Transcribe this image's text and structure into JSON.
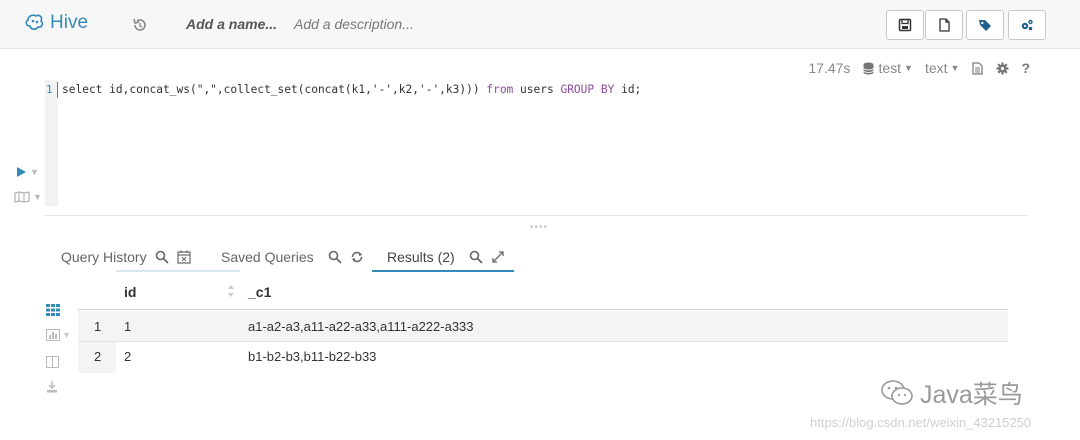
{
  "app": {
    "name": "Hive"
  },
  "header": {
    "name_placeholder": "Add a name...",
    "description_placeholder": "Add a description...",
    "buttons": [
      "save-icon",
      "new-file-icon",
      "tag-icon",
      "settings-cogs-icon"
    ]
  },
  "editor": {
    "elapsed": "17.47s",
    "database": "test",
    "format": "text",
    "line_number": "1",
    "query": {
      "p1": "select id,concat_ws(\",\",collect_set(concat(k1,'-',k2,'-',k3))) ",
      "kw_from": "from",
      "p2": " users ",
      "kw_group": "GROUP BY",
      "p3": " id;"
    },
    "help": "?"
  },
  "tabs": [
    {
      "label": "Query History",
      "active": false
    },
    {
      "label": "Saved Queries",
      "active": false
    },
    {
      "label": "Results (2)",
      "active": true
    }
  ],
  "results": {
    "columns": [
      "id",
      "_c1"
    ],
    "rows": [
      {
        "num": "1",
        "id": "1",
        "c1": "a1-a2-a3,a11-a22-a33,a111-a222-a333"
      },
      {
        "num": "2",
        "id": "2",
        "c1": "b1-b2-b3,b11-b22-b33"
      }
    ]
  },
  "watermark": {
    "brand": "Java菜鸟",
    "url": "https://blog.csdn.net/weixin_43215250"
  },
  "colors": {
    "accent": "#338bb8",
    "keyword": "#8a4a9c"
  }
}
